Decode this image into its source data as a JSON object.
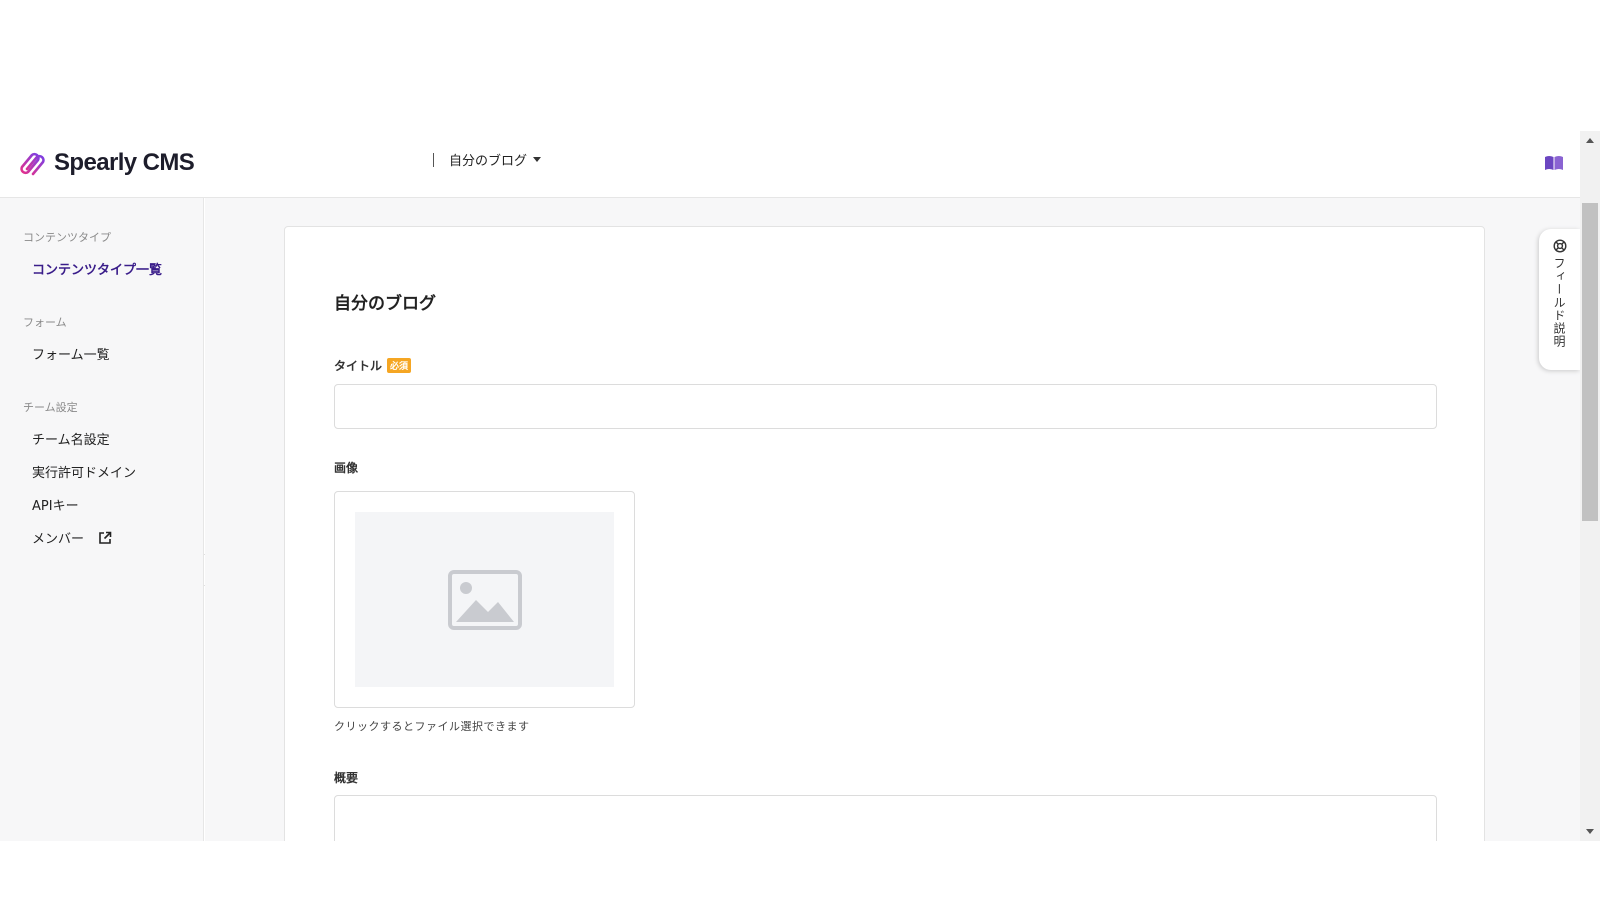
{
  "header": {
    "logo_text": "Spearly CMS",
    "blog_selector": "自分のブログ"
  },
  "sidebar": {
    "sections": [
      {
        "label": "コンテンツタイプ",
        "items": [
          {
            "label": "コンテンツタイプ一覧",
            "active": true
          }
        ]
      },
      {
        "label": "フォーム",
        "items": [
          {
            "label": "フォーム一覧"
          }
        ]
      },
      {
        "label": "チーム設定",
        "items": [
          {
            "label": "チーム名設定"
          },
          {
            "label": "実行許可ドメイン"
          },
          {
            "label": "APIキー"
          },
          {
            "label": "メンバー",
            "external": true
          }
        ]
      }
    ]
  },
  "main": {
    "title": "自分のブログ",
    "fields": {
      "title_label": "タイトル",
      "required_badge": "必須",
      "image_label": "画像",
      "image_hint": "クリックするとファイル選択できます",
      "summary_label": "概要"
    }
  },
  "help_tab": {
    "label": "フィールド説明"
  },
  "colors": {
    "accent": "#3a1d8a",
    "required": "#f5a623",
    "logo_gradient_start": "#7b3fe4",
    "logo_gradient_end": "#e5318b"
  }
}
